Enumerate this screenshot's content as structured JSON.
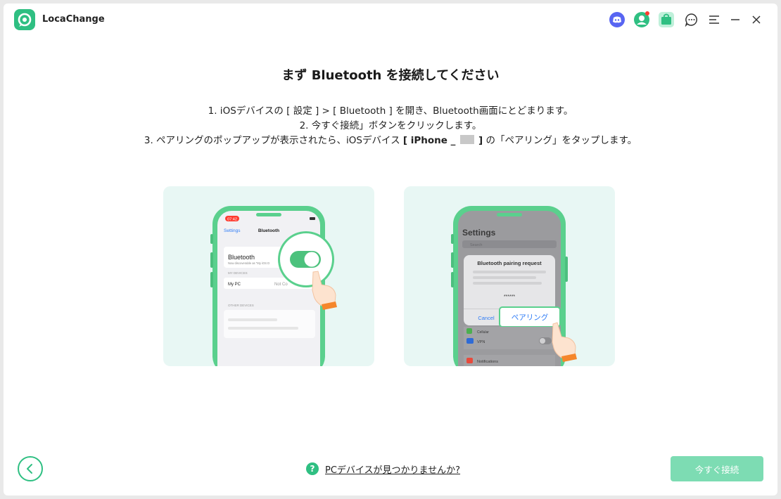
{
  "app": {
    "name": "LocaChange",
    "accent_color": "#2fbf82"
  },
  "titlebar": {
    "icons": [
      "discord-icon",
      "account-icon",
      "store-icon",
      "feedback-icon",
      "menu-icon",
      "minimize-icon",
      "close-icon"
    ]
  },
  "main": {
    "heading": "まず Bluetooth を接続してください",
    "step1": "1. iOSデバイスの [ 設定 ] > [ Bluetooth ] を開き、Bluetooth画面にとどまります。",
    "step2": "2. 今すぐ接続」ボタンをクリックします。",
    "step3_prefix": "3. ペアリングのポップアップが表示されたら、iOSデバイス",
    "step3_device": "[ iPhone _",
    "step3_device_end": "]",
    "step3_suffix": "の「ペアリング」をタップします。"
  },
  "illustration_left": {
    "status_time": "07:42",
    "nav_back": "Settings",
    "nav_title": "Bluetooth",
    "bt_label": "Bluetooth",
    "bt_sub": "Now discoverable as \"My iOS D",
    "my_devices_header": "MY DEVICES",
    "device_name": "My PC",
    "device_status": "Not Co",
    "other_devices_header": "OTHER DEVICES"
  },
  "illustration_right": {
    "settings_title": "Settings",
    "search_placeholder": "Search",
    "alert_title": "Bluetooth pairing request",
    "alert_code": "******",
    "cancel_label": "Cancel",
    "pair_label": "ペアリング",
    "row_cellular": "Cellular",
    "row_vpn": "VPN",
    "row_notifications": "Notifications"
  },
  "footer": {
    "help_icon": "?",
    "help_text": "PCデバイスが見つかりませんか?",
    "connect_label": "今すぐ接続"
  }
}
